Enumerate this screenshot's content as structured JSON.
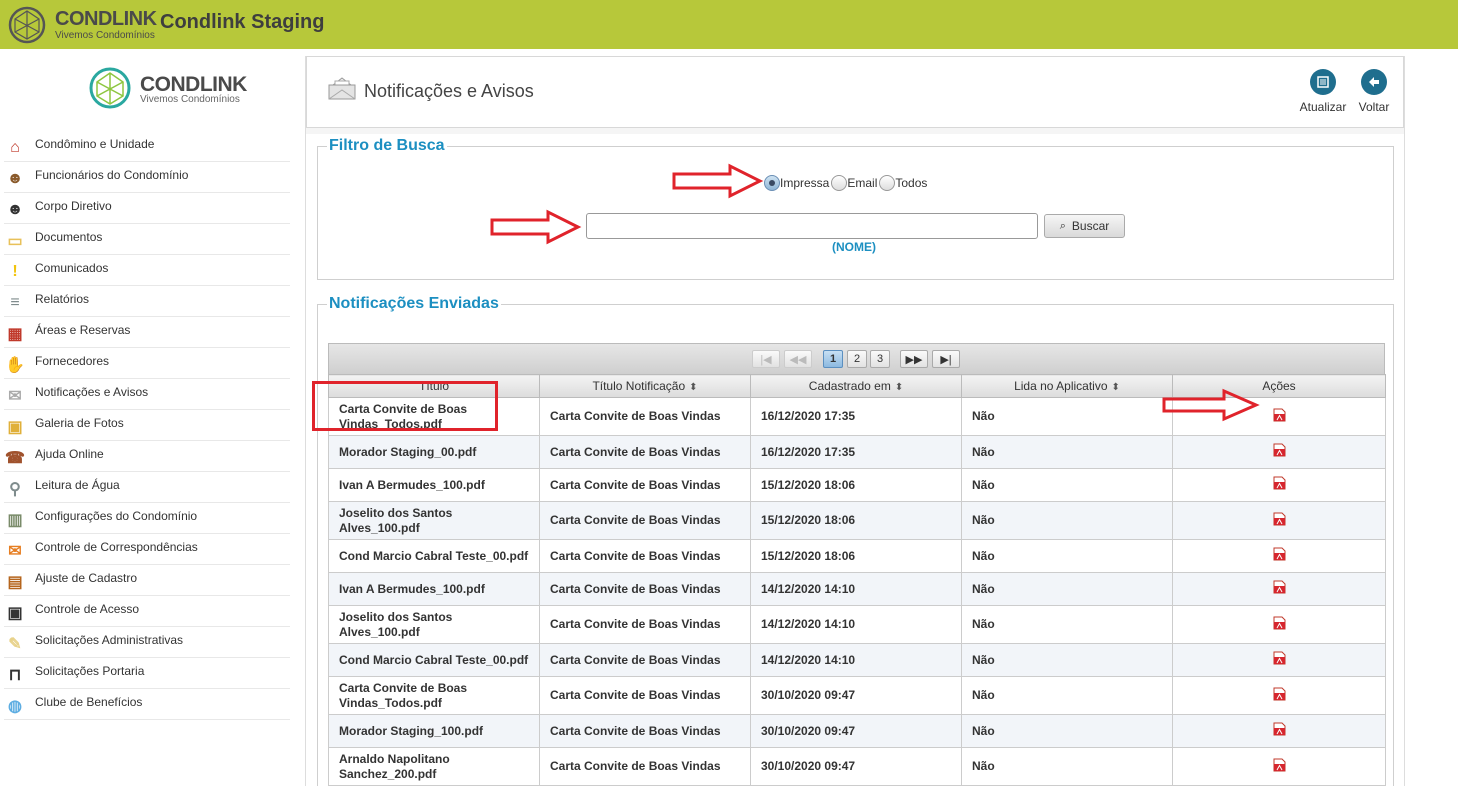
{
  "topbar": {
    "brand": "CONDLINK",
    "brand_sub": "Vivemos Condomínios",
    "app_title": "Condlink Staging"
  },
  "sidebar": {
    "brand": "CONDLINK",
    "brand_sub": "Vivemos Condomínios",
    "items": [
      {
        "label": "Condômino e Unidade",
        "icon": "house-person-icon"
      },
      {
        "label": "Funcionários do Condomínio",
        "icon": "staff-icon"
      },
      {
        "label": "Corpo Diretivo",
        "icon": "executive-icon"
      },
      {
        "label": "Documentos",
        "icon": "folder-icon"
      },
      {
        "label": "Comunicados",
        "icon": "alert-icon"
      },
      {
        "label": "Relatórios",
        "icon": "report-icon"
      },
      {
        "label": "Áreas e Reservas",
        "icon": "calendar-icon"
      },
      {
        "label": "Fornecedores",
        "icon": "handshake-icon"
      },
      {
        "label": "Notificações e Avisos",
        "icon": "envelope-icon"
      },
      {
        "label": "Galeria de Fotos",
        "icon": "photos-icon"
      },
      {
        "label": "Ajuda Online",
        "icon": "support-icon"
      },
      {
        "label": "Leitura de Água",
        "icon": "faucet-icon"
      },
      {
        "label": "Configurações do Condomínio",
        "icon": "buildings-icon"
      },
      {
        "label": "Controle de Correspondências",
        "icon": "mail-icon"
      },
      {
        "label": "Ajuste de Cadastro",
        "icon": "briefcase-icon"
      },
      {
        "label": "Controle de Acesso",
        "icon": "access-icon"
      },
      {
        "label": "Solicitações Administrativas",
        "icon": "notes-icon"
      },
      {
        "label": "Solicitações Portaria",
        "icon": "gate-icon"
      },
      {
        "label": "Clube de Benefícios",
        "icon": "globe-icon"
      }
    ]
  },
  "header": {
    "title": "Notificações e Avisos",
    "refresh_label": "Atualizar",
    "back_label": "Voltar"
  },
  "filter": {
    "legend": "Filtro de Busca",
    "options": [
      "Impressa",
      "Email",
      "Todos"
    ],
    "selected": "Impressa",
    "search_value": "",
    "search_button": "Buscar",
    "hint": "(NOME)"
  },
  "sent": {
    "legend": "Notificações Enviadas",
    "pager": {
      "pages": [
        "1",
        "2",
        "3"
      ],
      "current": "1"
    },
    "columns": [
      "Título",
      "Título Notificação",
      "Cadastrado em",
      "Lida no Aplicativo",
      "Ações"
    ],
    "rows": [
      {
        "titulo": "Carta Convite de Boas Vindas_Todos.pdf",
        "notificacao": "Carta Convite de Boas Vindas",
        "cadastrado": "16/12/2020 17:35",
        "lida": "Não"
      },
      {
        "titulo": "Morador Staging_00.pdf",
        "notificacao": "Carta Convite de Boas Vindas",
        "cadastrado": "16/12/2020 17:35",
        "lida": "Não"
      },
      {
        "titulo": "Ivan A Bermudes_100.pdf",
        "notificacao": "Carta Convite de Boas Vindas",
        "cadastrado": "15/12/2020 18:06",
        "lida": "Não"
      },
      {
        "titulo": "Joselito dos Santos Alves_100.pdf",
        "notificacao": "Carta Convite de Boas Vindas",
        "cadastrado": "15/12/2020 18:06",
        "lida": "Não"
      },
      {
        "titulo": "Cond Marcio Cabral Teste_00.pdf",
        "notificacao": "Carta Convite de Boas Vindas",
        "cadastrado": "15/12/2020 18:06",
        "lida": "Não"
      },
      {
        "titulo": "Ivan A Bermudes_100.pdf",
        "notificacao": "Carta Convite de Boas Vindas",
        "cadastrado": "14/12/2020 14:10",
        "lida": "Não"
      },
      {
        "titulo": "Joselito dos Santos Alves_100.pdf",
        "notificacao": "Carta Convite de Boas Vindas",
        "cadastrado": "14/12/2020 14:10",
        "lida": "Não"
      },
      {
        "titulo": "Cond Marcio Cabral Teste_00.pdf",
        "notificacao": "Carta Convite de Boas Vindas",
        "cadastrado": "14/12/2020 14:10",
        "lida": "Não"
      },
      {
        "titulo": "Carta Convite de Boas Vindas_Todos.pdf",
        "notificacao": "Carta Convite de Boas Vindas",
        "cadastrado": "30/10/2020 09:47",
        "lida": "Não"
      },
      {
        "titulo": "Morador Staging_100.pdf",
        "notificacao": "Carta Convite de Boas Vindas",
        "cadastrado": "30/10/2020 09:47",
        "lida": "Não"
      },
      {
        "titulo": "Arnaldo Napolitano Sanchez_200.pdf",
        "notificacao": "Carta Convite de Boas Vindas",
        "cadastrado": "30/10/2020 09:47",
        "lida": "Não"
      }
    ]
  },
  "colors": {
    "topbar": "#b7c83a",
    "accent": "#1c8fc1",
    "annotation": "#e0232b"
  }
}
